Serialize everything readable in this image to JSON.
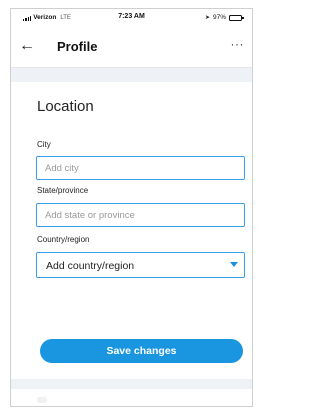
{
  "status_bar": {
    "carrier": "Verizon",
    "network": "LTE",
    "time": "7:23 AM",
    "battery": "97%",
    "battery_level": 0.97,
    "icons": [
      "signal-icon",
      "location-icon",
      "battery-icon"
    ]
  },
  "nav": {
    "back_icon": "←",
    "title": "Profile",
    "more_icon": "···"
  },
  "section": {
    "title": "Location"
  },
  "fields": {
    "city": {
      "label": "City",
      "placeholder": "Add city",
      "value": ""
    },
    "state": {
      "label": "State/province",
      "placeholder": "Add state or province",
      "value": ""
    },
    "country": {
      "label": "Country/region",
      "selected": "Add country/region"
    }
  },
  "actions": {
    "save_label": "Save changes"
  },
  "colors": {
    "accent": "#1a95e0",
    "field_border": "#38a0e6",
    "band": "#eef2f7"
  }
}
